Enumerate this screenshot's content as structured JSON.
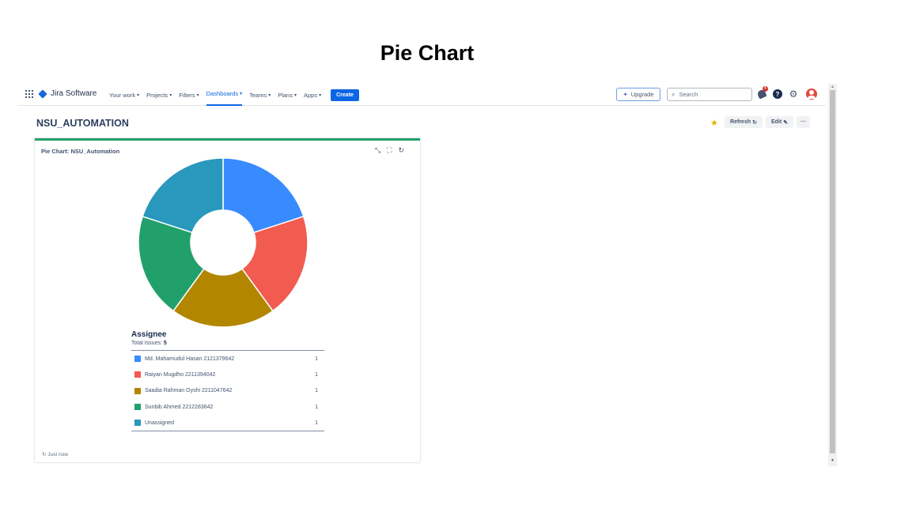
{
  "document": {
    "title": "Pie Chart"
  },
  "topnav": {
    "product_name": "Jira Software",
    "items": [
      {
        "label": "Your work",
        "active": false
      },
      {
        "label": "Projects",
        "active": false
      },
      {
        "label": "Filters",
        "active": false
      },
      {
        "label": "Dashboards",
        "active": true
      },
      {
        "label": "Teams",
        "active": false
      },
      {
        "label": "Plans",
        "active": false
      },
      {
        "label": "Apps",
        "active": false
      }
    ],
    "create_label": "Create",
    "upgrade_label": "Upgrade",
    "search_placeholder": "Search",
    "notification_count": "4"
  },
  "dashboard": {
    "title": "NSU_AUTOMATION",
    "refresh_label": "Refresh",
    "edit_label": "Edit",
    "more_label": "···"
  },
  "gadget": {
    "title": "Pie Chart: NSU_Automation",
    "legend_title": "Assignee",
    "total_label": "Total Issues:",
    "total_value": "5",
    "last_updated": "Just now"
  },
  "chart_data": {
    "type": "pie",
    "style": "donut",
    "title": "Pie Chart: NSU_Automation",
    "legend_title": "Assignee",
    "categories": [
      "Md. Mahamudul Hasan 2121379642",
      "Raiyan Mugdho 2211394042",
      "Saadia Rahman Oyshi 2211047642",
      "Sunbib Ahmed 2212283642",
      "Unassigned"
    ],
    "values": [
      1,
      1,
      1,
      1,
      1
    ],
    "colors": [
      "#388bff",
      "#f15b50",
      "#b38600",
      "#22a06b",
      "#2898bd"
    ]
  }
}
